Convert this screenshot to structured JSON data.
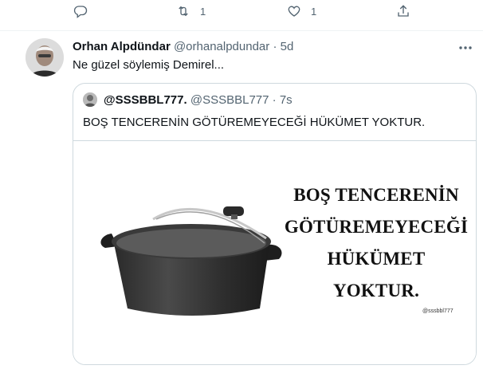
{
  "prev_actions": {
    "reply": {
      "icon": "reply-icon"
    },
    "retweet": {
      "icon": "retweet-icon",
      "count": "1"
    },
    "like": {
      "icon": "like-icon",
      "count": "1"
    },
    "share": {
      "icon": "share-icon"
    }
  },
  "tweet": {
    "name": "Orhan Alpdündar",
    "handle": "@orhanalpdundar",
    "separator": "·",
    "time": "5d",
    "text": "Ne güzel söylemiş Demirel...",
    "more_icon": "more-icon"
  },
  "quote": {
    "name": "@SSSBBL777.",
    "handle": "@SSSBBL777",
    "separator": "·",
    "time": "7s",
    "text": "BOŞ TENCERENİN GÖTÜREMEYECEĞİ HÜKÜMET YOKTUR.",
    "image": {
      "lines": [
        "BOŞ TENCERENİN",
        "GÖTÜREMEYECEĞİ",
        "HÜKÜMET",
        "YOKTUR."
      ],
      "watermark": "@sssbbl777"
    }
  },
  "colors": {
    "secondary_text": "#536471",
    "border": "#cfd9de"
  }
}
